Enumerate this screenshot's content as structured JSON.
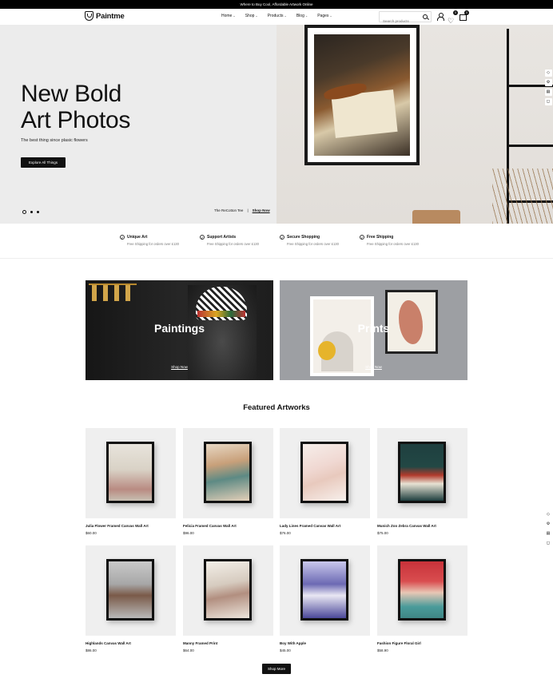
{
  "topbar": {
    "text": "Where to Buy Cool, Affordable Artwork Online"
  },
  "header": {
    "logo": "Paintme",
    "nav": [
      {
        "label": "Home"
      },
      {
        "label": "Shop"
      },
      {
        "label": "Products"
      },
      {
        "label": "Blog"
      },
      {
        "label": "Pages"
      }
    ],
    "search_placeholder": "Search products",
    "wishlist_count": "0",
    "cart_count": "0"
  },
  "hero": {
    "title_line1": "New Bold",
    "title_line2": "Art Photos",
    "subtitle": "The best thing since plasic flowers",
    "button": "Explore All Things",
    "product_caption": "The ReCotton Tee",
    "shop_link": "Shop Now"
  },
  "features": [
    {
      "title": "Unique Art",
      "sub": "Free Shipping for orders over £130"
    },
    {
      "title": "Support Artists",
      "sub": "Free Shipping for orders over £130"
    },
    {
      "title": "Secure Shopping",
      "sub": "Free Shipping for orders over £130"
    },
    {
      "title": "Free Shipping",
      "sub": "Free Shipping for orders over £130"
    }
  ],
  "categories": [
    {
      "label": "Paintings",
      "link": "Shop Now"
    },
    {
      "label": "Prints",
      "link": "Shop Now"
    }
  ],
  "featured": {
    "title": "Featured Artworks",
    "products": [
      {
        "name": "Julia Flower Framed Canvas Wall Art",
        "price": "$60.00",
        "art": "linear-gradient(180deg,#e8e4dc 0%,#d9d2c6 45%,#b98b82 80%,#c7bfb2 100%)"
      },
      {
        "name": "Felicia Framed Canvas Wall Art",
        "price": "$96.00",
        "art": "linear-gradient(170deg,#e8d8c4 0%,#c8a07a 35%,#5d8a84 60%,#e3cfb8 100%)"
      },
      {
        "name": "Lady Lines Framed Canvas Wall Art",
        "price": "$76.00",
        "art": "linear-gradient(160deg,#f6eeea 0%,#f0d8d2 40%,#e8c9bd 60%,#f7f0ec 100%)"
      },
      {
        "name": "Munich Zoo Zebra Canvas Wall Art",
        "price": "$75.00",
        "art": "linear-gradient(180deg,#1f3f3f 0%,#224845 40%,#b23a2c 55%,#e7e2d3 70%,#1f3f3f 100%)"
      },
      {
        "name": "Highlands Canvas Wall Art",
        "price": "$86.00",
        "art": "linear-gradient(180deg,#c9c9c9 0%,#a7a7a7 40%,#7a5a48 60%,#b9b9b9 100%)"
      },
      {
        "name": "Manny Framed Print",
        "price": "$64.00",
        "art": "linear-gradient(170deg,#f3efe8 0%,#d6cbbf 40%,#b28f80 60%,#ece5dc 100%)"
      },
      {
        "name": "Boy With Apple",
        "price": "$45.00",
        "art": "linear-gradient(180deg,#c9c8ec 0%,#6c69b3 40%,#e9e7f3 60%,#4b4899 100%)"
      },
      {
        "name": "Fashion Figure Floral Girl",
        "price": "$58.90",
        "art": "linear-gradient(180deg,#c8323a 0%,#d94d4f 35%,#e8c7b5 55%,#4a9b9a 80%,#3f8685 100%)"
      }
    ],
    "more_button": "Shop More"
  }
}
